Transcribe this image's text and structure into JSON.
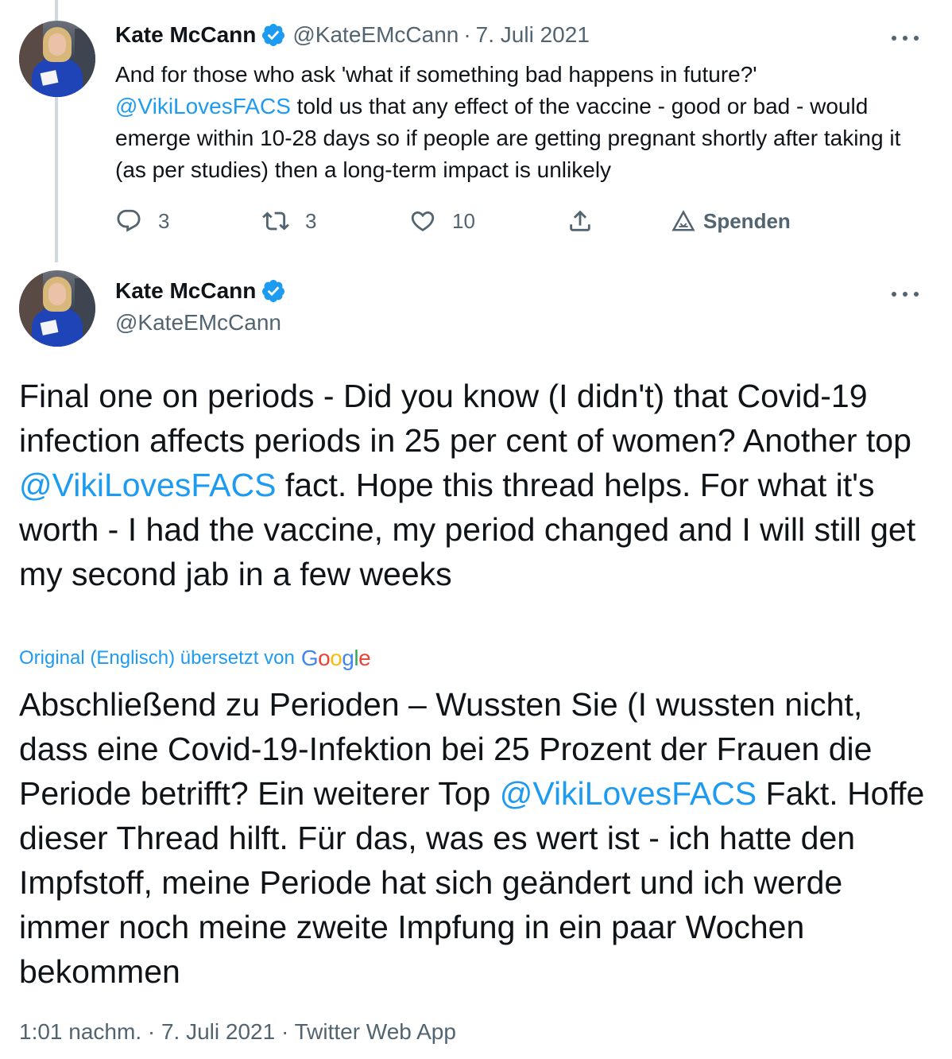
{
  "reply_tweet": {
    "author_name": "Kate McCann",
    "handle": "@KateEMcCann",
    "separator": "·",
    "date": "7. Juli 2021",
    "text_before_mention": "And for those who ask 'what if something bad happens in future?'",
    "mention": "@VikiLovesFACS",
    "text_after_mention": " told us that any effect of the vaccine - good or bad - would emerge within 10-28 days so if people are getting pregnant shortly after taking it (as per studies) then a long-term impact is unlikely",
    "actions": {
      "reply_count": "3",
      "retweet_count": "3",
      "like_count": "10",
      "donate_label": "Spenden"
    },
    "icons": [
      "reply-icon",
      "retweet-icon",
      "like-icon",
      "share-icon",
      "donate-icon",
      "more-icon",
      "verified-badge-icon"
    ]
  },
  "main_tweet": {
    "author_name": "Kate McCann",
    "handle": "@KateEMcCann",
    "original_text_before_mention": "Final one on periods - Did you know (I didn't) that Covid-19 infection affects periods in 25 per cent of women? Another top ",
    "original_mention": "@VikiLovesFACS",
    "original_text_after_mention": " fact. Hope this thread helps. For what it's worth - I had the vaccine, my period changed and I will still get my second jab in a few weeks",
    "translation_label": "Original (Englisch) übersetzt von",
    "translation_provider": "Google",
    "translated_text_before_mention": "Abschließend zu Perioden – Wussten Sie (I wussten nicht, dass eine Covid-19-Infektion bei 25 Prozent der Frauen die Periode betrifft? Ein weiterer Top ",
    "translated_mention": "@VikiLovesFACS",
    "translated_text_after_mention": " Fakt. Hoffe dieser Thread hilft. Für das, was es wert ist - ich hatte den Impfstoff, meine Periode hat sich geändert und ich werde immer noch meine zweite Impfung in ein paar Wochen bekommen",
    "meta": "1:01 nachm. · 7. Juli 2021 · Twitter Web App"
  },
  "colors": {
    "accent": "#1d9bf0",
    "text": "#0f1419",
    "secondary": "#536471",
    "thread_line": "#cfd9de"
  }
}
